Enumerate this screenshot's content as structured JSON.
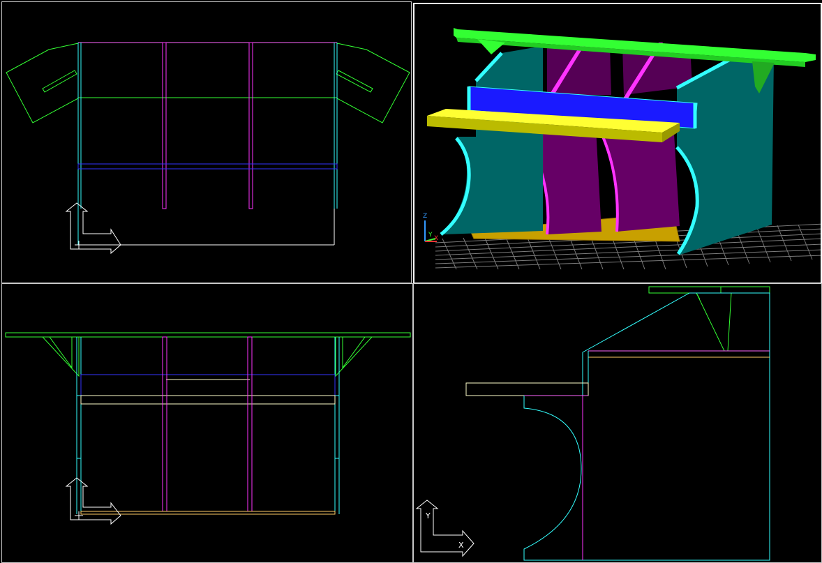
{
  "colors": {
    "background": "#000000",
    "green": "#33ff33",
    "cyan": "#33ffff",
    "magenta": "#ff33ff",
    "blue": "#3333ff",
    "yellow": "#ffff66",
    "teal_face": "#006666",
    "purple_face": "#660066",
    "olive_face": "#c8a000",
    "active_border": "#ffffff"
  },
  "viewports": {
    "top": {
      "ucs": {
        "y_label": "",
        "x_label": ""
      }
    },
    "perspective": {
      "ucs": {
        "z_label": "Z",
        "y_label": "Y",
        "x_label": "X"
      }
    },
    "front": {
      "ucs": {
        "y_label": "",
        "x_label": ""
      }
    },
    "side": {
      "ucs": {
        "y_label": "Y",
        "x_label": "X"
      }
    }
  }
}
